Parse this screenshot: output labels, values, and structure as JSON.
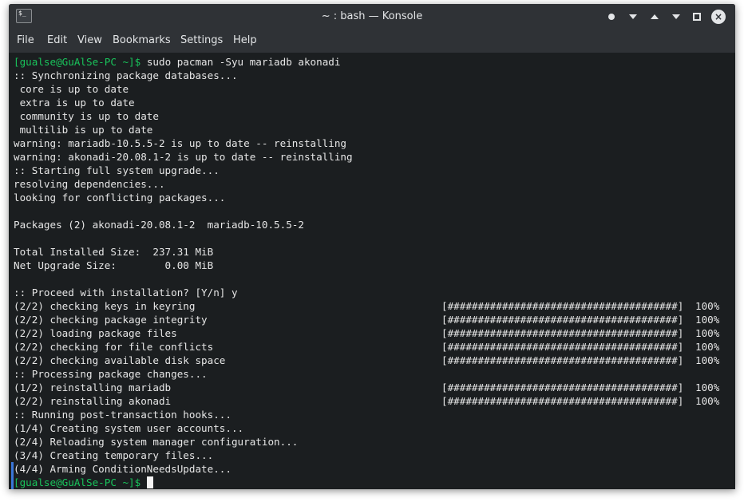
{
  "window": {
    "title": "~ : bash — Konsole",
    "app_icon_text": "$_"
  },
  "menu": [
    "File",
    "Edit",
    "View",
    "Bookmarks",
    "Settings",
    "Help"
  ],
  "terminal": {
    "prompt_text": "[gualse@GuAlSe-PC ~]$",
    "command": " sudo pacman -Syu mariadb akonadi",
    "output_lines": [
      ":: Synchronizing package databases...",
      " core is up to date",
      " extra is up to date",
      " community is up to date",
      " multilib is up to date",
      "warning: mariadb-10.5.5-2 is up to date -- reinstalling",
      "warning: akonadi-20.08.1-2 is up to date -- reinstalling",
      ":: Starting full system upgrade...",
      "resolving dependencies...",
      "looking for conflicting packages...",
      "",
      "Packages (2) akonadi-20.08.1-2  mariadb-10.5.5-2",
      "",
      "Total Installed Size:  237.31 MiB",
      "Net Upgrade Size:        0.00 MiB",
      "",
      ":: Proceed with installation? [Y/n] y",
      "(2/2) checking keys in keyring",
      "(2/2) checking package integrity",
      "(2/2) loading package files",
      "(2/2) checking for file conflicts",
      "(2/2) checking available disk space",
      ":: Processing package changes...",
      "(1/2) reinstalling mariadb",
      "(2/2) reinstalling akonadi",
      ":: Running post-transaction hooks...",
      "(1/4) Creating system user accounts...",
      "(2/4) Reloading system manager configuration...",
      "(3/4) Creating temporary files...",
      "(4/4) Arming ConditionNeedsUpdate..."
    ],
    "progress_bar": "[######################################]",
    "progress_percent": "100%",
    "final_prompt": "[gualse@GuAlSe-PC ~]$"
  },
  "colors": {
    "prompt": "#19c35b",
    "background": "#1b1e20",
    "text": "#e6e6e6",
    "titlebar": "#2f3236"
  }
}
